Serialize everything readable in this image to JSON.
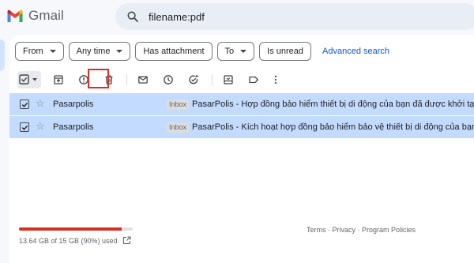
{
  "app": {
    "name": "Gmail",
    "brand_colors": {
      "red": "#ea4335",
      "blue": "#4285f4",
      "green": "#34a853",
      "yellow": "#fbbc04",
      "dark_red": "#c5221f"
    }
  },
  "search": {
    "value": "filename:pdf",
    "icon": "search-icon"
  },
  "filters": {
    "chips": [
      {
        "label": "From",
        "has_dropdown": true
      },
      {
        "label": "Any time",
        "has_dropdown": true
      },
      {
        "label": "Has attachment",
        "has_dropdown": false
      },
      {
        "label": "To",
        "has_dropdown": true
      },
      {
        "label": "Is unread",
        "has_dropdown": false
      }
    ],
    "advanced_search": "Advanced search"
  },
  "toolbar": {
    "actions": [
      "select-all-icon",
      "archive-icon",
      "report-spam-icon",
      "delete-icon",
      "mark-unread-icon",
      "snooze-icon",
      "add-to-tasks-icon",
      "move-to-icon",
      "label-icon",
      "more-options-icon"
    ],
    "highlighted_action": "delete-icon",
    "highlight_color": "#d93025"
  },
  "messages": [
    {
      "selected": true,
      "starred": false,
      "sender": "Pasarpolis",
      "label": "Inbox",
      "subject": "PasarPolis - Hợp đồng bảo hiểm thiết bị di động của bạn đã được khởi tạo thà"
    },
    {
      "selected": true,
      "starred": false,
      "sender": "Pasarpolis",
      "label": "Inbox",
      "subject": "PasarPolis - Kích hoạt hợp đồng bảo hiểm bảo vệ thiết bị di động của bạn - Kí"
    }
  ],
  "storage": {
    "text": "13.64 GB of 15 GB (90%) used",
    "fraction_used": 0.9,
    "bar_color": "#d93025"
  },
  "footer": {
    "links": "Terms · Privacy · Program Policies"
  },
  "colors": {
    "selected_row": "#c2dbff",
    "search_bg": "#e9eef6",
    "page_bg": "#f6f8fc",
    "link": "#0b57d0"
  }
}
